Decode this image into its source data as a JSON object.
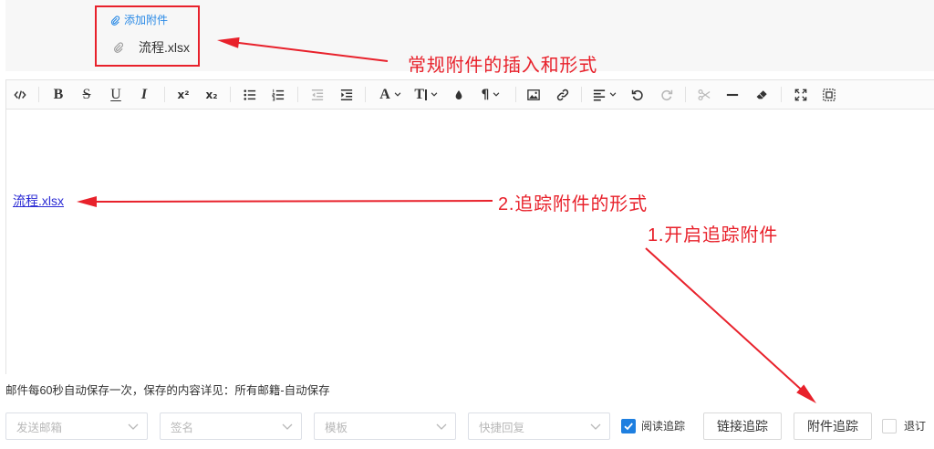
{
  "attachments": {
    "add_label": "添加附件",
    "add_icon": "paperclip-icon",
    "files": [
      {
        "name": "流程.xlsx",
        "icon": "paperclip-icon"
      }
    ]
  },
  "toolbar": {
    "bold": "B",
    "strikethrough": "S",
    "underline": "U",
    "italic": "I",
    "superscript": "x²",
    "subscript": "x₂",
    "font_color": "A",
    "font_size": "T",
    "paragraph": "¶",
    "icons": [
      "code-icon",
      "bullet-list-icon",
      "ordered-list-icon",
      "outdent-icon",
      "indent-icon",
      "chevron-down-icon",
      "drop-icon",
      "image-icon",
      "link-icon",
      "align-left-icon",
      "undo-icon",
      "redo-icon",
      "cut-icon",
      "horizontal-rule-icon",
      "eraser-icon",
      "fullscreen-icon",
      "select-all-icon"
    ],
    "states": {
      "outdent_disabled": true,
      "redo_disabled": true,
      "cut_disabled": true
    }
  },
  "editor": {
    "tracked_attachment": "流程.xlsx"
  },
  "autosave_notice": "邮件每60秒自动保存一次，保存的内容详见：所有邮籍-自动保存",
  "footer": {
    "selects": [
      {
        "placeholder": "发送邮箱"
      },
      {
        "placeholder": "签名"
      },
      {
        "placeholder": "模板"
      },
      {
        "placeholder": "快捷回复"
      }
    ],
    "read_tracking": {
      "label": "阅读追踪",
      "checked": true
    },
    "link_tracking_button": "链接追踪",
    "attachment_tracking_button": "附件追踪",
    "unsubscribe": {
      "label": "退订",
      "checked": false
    }
  },
  "annotations": {
    "regular_attachment_note": "常规附件的插入和形式",
    "tracked_attachment_note": "2.追踪附件的形式",
    "enable_tracking_note": "1.开启追踪附件"
  },
  "colors": {
    "annotation_red": "#e8212b",
    "accent_blue": "#1e7fe0",
    "add_attachment_blue": "#2a8ae6",
    "tracked_link_blue": "#2a2ad4"
  }
}
